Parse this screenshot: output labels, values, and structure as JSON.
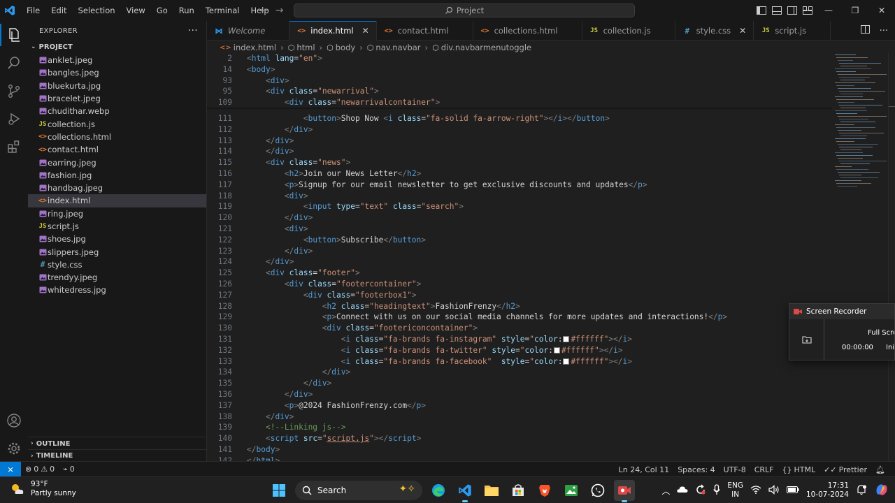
{
  "titlebar": {
    "menu": [
      "File",
      "Edit",
      "Selection",
      "View",
      "Go",
      "Run",
      "Terminal",
      "Help"
    ],
    "search_placeholder": "Project"
  },
  "sidebar": {
    "title": "EXPLORER",
    "more": "···",
    "project_label": "PROJECT",
    "files": [
      {
        "name": "anklet.jpeg",
        "type": "image"
      },
      {
        "name": "bangles.jpeg",
        "type": "image"
      },
      {
        "name": "bluekurta.jpg",
        "type": "image"
      },
      {
        "name": "bracelet.jpeg",
        "type": "image"
      },
      {
        "name": "chudithar.webp",
        "type": "image"
      },
      {
        "name": "collection.js",
        "type": "js"
      },
      {
        "name": "collections.html",
        "type": "html"
      },
      {
        "name": "contact.html",
        "type": "html"
      },
      {
        "name": "earring.jpeg",
        "type": "image"
      },
      {
        "name": "fashion.jpg",
        "type": "image"
      },
      {
        "name": "handbag.jpeg",
        "type": "image"
      },
      {
        "name": "index.html",
        "type": "html",
        "selected": true
      },
      {
        "name": "ring.jpeg",
        "type": "image"
      },
      {
        "name": "script.js",
        "type": "js"
      },
      {
        "name": "shoes.jpg",
        "type": "image"
      },
      {
        "name": "slippers.jpeg",
        "type": "image"
      },
      {
        "name": "style.css",
        "type": "css"
      },
      {
        "name": "trendyy.jpeg",
        "type": "image"
      },
      {
        "name": "whitedress.jpg",
        "type": "image"
      }
    ],
    "outline_label": "OUTLINE",
    "timeline_label": "TIMELINE"
  },
  "tabs": [
    {
      "label": "Welcome",
      "type": "vscode",
      "italic": true
    },
    {
      "label": "index.html",
      "type": "html",
      "active": true
    },
    {
      "label": "contact.html",
      "type": "html"
    },
    {
      "label": "collections.html",
      "type": "html"
    },
    {
      "label": "collection.js",
      "type": "js"
    },
    {
      "label": "style.css",
      "type": "css",
      "close": true
    },
    {
      "label": "script.js",
      "type": "js"
    }
  ],
  "breadcrumb": [
    "index.html",
    "html",
    "body",
    "nav.navbar",
    "div.navbarmenutoggle"
  ],
  "editor": {
    "sticky_lines": [
      {
        "n": "2",
        "html": "<span class=\"p\">&lt;</span><span class=\"t\">html</span> <span class=\"a\">lang</span><span class=\"x\">=</span><span class=\"s\">\"en\"</span><span class=\"p\">&gt;</span>"
      },
      {
        "n": "14",
        "html": "<span class=\"p\">&lt;</span><span class=\"t\">body</span><span class=\"p\">&gt;</span>"
      },
      {
        "n": "93",
        "html": "    <span class=\"p\">&lt;</span><span class=\"t\">div</span><span class=\"p\">&gt;</span>"
      },
      {
        "n": "95",
        "html": "    <span class=\"p\">&lt;</span><span class=\"t\">div</span> <span class=\"a\">class</span><span class=\"x\">=</span><span class=\"s\">\"newarrival\"</span><span class=\"p\">&gt;</span>"
      },
      {
        "n": "109",
        "html": "        <span class=\"p\">&lt;</span><span class=\"t\">div</span> <span class=\"a\">class</span><span class=\"x\">=</span><span class=\"s\">\"newarrivalcontainer\"</span><span class=\"p\">&gt;</span>"
      }
    ],
    "lines": [
      {
        "n": "111",
        "html": "            <span class=\"p\">&lt;</span><span class=\"t\">button</span><span class=\"p\">&gt;</span><span class=\"x\">Shop Now </span><span class=\"p\">&lt;</span><span class=\"t\">i</span> <span class=\"a\">class</span><span class=\"x\">=</span><span class=\"s\">\"fa-solid fa-arrow-right\"</span><span class=\"p\">&gt;&lt;/</span><span class=\"t\">i</span><span class=\"p\">&gt;&lt;/</span><span class=\"t\">button</span><span class=\"p\">&gt;</span>"
      },
      {
        "n": "112",
        "html": "        <span class=\"p\">&lt;/</span><span class=\"t\">div</span><span class=\"p\">&gt;</span>"
      },
      {
        "n": "113",
        "html": "    <span class=\"p\">&lt;/</span><span class=\"t\">div</span><span class=\"p\">&gt;</span>"
      },
      {
        "n": "114",
        "html": "    <span class=\"p\">&lt;/</span><span class=\"t\">div</span><span class=\"p\">&gt;</span>"
      },
      {
        "n": "115",
        "html": "    <span class=\"p\">&lt;</span><span class=\"t\">div</span> <span class=\"a\">class</span><span class=\"x\">=</span><span class=\"s\">\"news\"</span><span class=\"p\">&gt;</span>"
      },
      {
        "n": "116",
        "html": "        <span class=\"p\">&lt;</span><span class=\"t\">h2</span><span class=\"p\">&gt;</span><span class=\"x\">Join our News Letter</span><span class=\"p\">&lt;/</span><span class=\"t\">h2</span><span class=\"p\">&gt;</span>"
      },
      {
        "n": "117",
        "html": "        <span class=\"p\">&lt;</span><span class=\"t\">p</span><span class=\"p\">&gt;</span><span class=\"x\">Signup for our email newsletter to get exclusive discounts and updates</span><span class=\"p\">&lt;/</span><span class=\"t\">p</span><span class=\"p\">&gt;</span>"
      },
      {
        "n": "118",
        "html": "        <span class=\"p\">&lt;</span><span class=\"t\">div</span><span class=\"p\">&gt;</span>"
      },
      {
        "n": "119",
        "html": "            <span class=\"p\">&lt;</span><span class=\"t\">input</span> <span class=\"a\">type</span><span class=\"x\">=</span><span class=\"s\">\"text\"</span> <span class=\"a\">class</span><span class=\"x\">=</span><span class=\"s\">\"search\"</span><span class=\"p\">&gt;</span>"
      },
      {
        "n": "120",
        "html": "        <span class=\"p\">&lt;/</span><span class=\"t\">div</span><span class=\"p\">&gt;</span>"
      },
      {
        "n": "121",
        "html": "        <span class=\"p\">&lt;</span><span class=\"t\">div</span><span class=\"p\">&gt;</span>"
      },
      {
        "n": "122",
        "html": "            <span class=\"p\">&lt;</span><span class=\"t\">button</span><span class=\"p\">&gt;</span><span class=\"x\">Subscribe</span><span class=\"p\">&lt;/</span><span class=\"t\">button</span><span class=\"p\">&gt;</span>"
      },
      {
        "n": "123",
        "html": "        <span class=\"p\">&lt;/</span><span class=\"t\">div</span><span class=\"p\">&gt;</span>"
      },
      {
        "n": "124",
        "html": "    <span class=\"p\">&lt;/</span><span class=\"t\">div</span><span class=\"p\">&gt;</span>"
      },
      {
        "n": "125",
        "html": "    <span class=\"p\">&lt;</span><span class=\"t\">div</span> <span class=\"a\">class</span><span class=\"x\">=</span><span class=\"s\">\"footer\"</span><span class=\"p\">&gt;</span>"
      },
      {
        "n": "126",
        "html": "        <span class=\"p\">&lt;</span><span class=\"t\">div</span> <span class=\"a\">class</span><span class=\"x\">=</span><span class=\"s\">\"footercontainer\"</span><span class=\"p\">&gt;</span>"
      },
      {
        "n": "127",
        "html": "            <span class=\"p\">&lt;</span><span class=\"t\">div</span> <span class=\"a\">class</span><span class=\"x\">=</span><span class=\"s\">\"footerbox1\"</span><span class=\"p\">&gt;</span>"
      },
      {
        "n": "128",
        "html": "                <span class=\"p\">&lt;</span><span class=\"t\">h2</span> <span class=\"a\">class</span><span class=\"x\">=</span><span class=\"s\">\"headingtext\"</span><span class=\"p\">&gt;</span><span class=\"x\">FashionFrenzy</span><span class=\"p\">&lt;/</span><span class=\"t\">h2</span><span class=\"p\">&gt;</span>"
      },
      {
        "n": "129",
        "html": "                <span class=\"p\">&lt;</span><span class=\"t\">p</span><span class=\"p\">&gt;</span><span class=\"x\">Connect with us on our social media channels for more updates and interactions!</span><span class=\"p\">&lt;/</span><span class=\"t\">p</span><span class=\"p\">&gt;</span>"
      },
      {
        "n": "130",
        "html": "                <span class=\"p\">&lt;</span><span class=\"t\">div</span> <span class=\"a\">class</span><span class=\"x\">=</span><span class=\"s\">\"footericoncontainer\"</span><span class=\"p\">&gt;</span>"
      },
      {
        "n": "131",
        "html": "                    <span class=\"p\">&lt;</span><span class=\"t\">i</span> <span class=\"a\">class</span><span class=\"x\">=</span><span class=\"s\">\"fa-brands fa-instagram\"</span> <span class=\"a\">style</span><span class=\"x\">=</span><span class=\"s\">\"</span><span class=\"a\">color</span><span class=\"x\">:</span><span class=\"sw\"></span><span class=\"s\">#ffffff\"</span><span class=\"p\">&gt;&lt;/</span><span class=\"t\">i</span><span class=\"p\">&gt;</span>"
      },
      {
        "n": "132",
        "html": "                    <span class=\"p\">&lt;</span><span class=\"t\">i</span> <span class=\"a\">class</span><span class=\"x\">=</span><span class=\"s\">\"fa-brands fa-twitter\"</span> <span class=\"a\">style</span><span class=\"x\">=</span><span class=\"s\">\"</span><span class=\"a\">color</span><span class=\"x\">:</span><span class=\"sw\"></span><span class=\"s\">#ffffff\"</span><span class=\"p\">&gt;&lt;/</span><span class=\"t\">i</span><span class=\"p\">&gt;</span>"
      },
      {
        "n": "133",
        "html": "                    <span class=\"p\">&lt;</span><span class=\"t\">i</span> <span class=\"a\">class</span><span class=\"x\">=</span><span class=\"s\">\"fa-brands fa-facebook\"</span>  <span class=\"a\">style</span><span class=\"x\">=</span><span class=\"s\">\"</span><span class=\"a\">color</span><span class=\"x\">:</span><span class=\"sw\"></span><span class=\"s\">#ffffff\"</span><span class=\"p\">&gt;&lt;/</span><span class=\"t\">i</span><span class=\"p\">&gt;</span>"
      },
      {
        "n": "134",
        "html": "                <span class=\"p\">&lt;/</span><span class=\"t\">div</span><span class=\"p\">&gt;</span>"
      },
      {
        "n": "135",
        "html": "            <span class=\"p\">&lt;/</span><span class=\"t\">div</span><span class=\"p\">&gt;</span>"
      },
      {
        "n": "136",
        "html": "        <span class=\"p\">&lt;/</span><span class=\"t\">div</span><span class=\"p\">&gt;</span>"
      },
      {
        "n": "137",
        "html": "        <span class=\"p\">&lt;</span><span class=\"t\">p</span><span class=\"p\">&gt;</span><span class=\"x\">@2024 FashionFrenzy.com</span><span class=\"p\">&lt;/</span><span class=\"t\">p</span><span class=\"p\">&gt;</span>"
      },
      {
        "n": "138",
        "html": "    <span class=\"p\">&lt;/</span><span class=\"t\">div</span><span class=\"p\">&gt;</span>"
      },
      {
        "n": "139",
        "html": "    <span class=\"c\">&lt;!--Linking js--&gt;</span>"
      },
      {
        "n": "140",
        "html": "    <span class=\"p\">&lt;</span><span class=\"t\">script</span> <span class=\"a\">src</span><span class=\"x\">=</span><span class=\"s\">\"<span class=\"u\">script.js</span>\"</span><span class=\"p\">&gt;&lt;/</span><span class=\"t\">script</span><span class=\"p\">&gt;</span>"
      },
      {
        "n": "141",
        "html": "<span class=\"p\">&lt;/</span><span class=\"t\">body</span><span class=\"p\">&gt;</span>"
      },
      {
        "n": "142",
        "html": "<span class=\"p\">&lt;/</span><span class=\"t\">html</span><span class=\"p\">&gt;</span>"
      }
    ]
  },
  "statusbar": {
    "errors": "0",
    "warnings": "0",
    "ports": "0",
    "position": "Ln 24, Col 11",
    "spaces": "Spaces: 4",
    "encoding": "UTF-8",
    "eol": "CRLF",
    "language": "HTML",
    "formatter": "Prettier"
  },
  "recorder": {
    "title": "Screen Recorder",
    "mode": "Full Screen",
    "time": "00:00:00",
    "status": "Initiating"
  },
  "taskbar": {
    "temperature": "93°F",
    "condition": "Partly sunny",
    "search_label": "Search",
    "lang_top": "ENG",
    "lang_bottom": "IN",
    "time": "17:31",
    "date": "10-07-2024"
  },
  "colors": {
    "accent": "#0078d4",
    "editor_bg": "#1f1f1f",
    "chrome_bg": "#181818"
  }
}
